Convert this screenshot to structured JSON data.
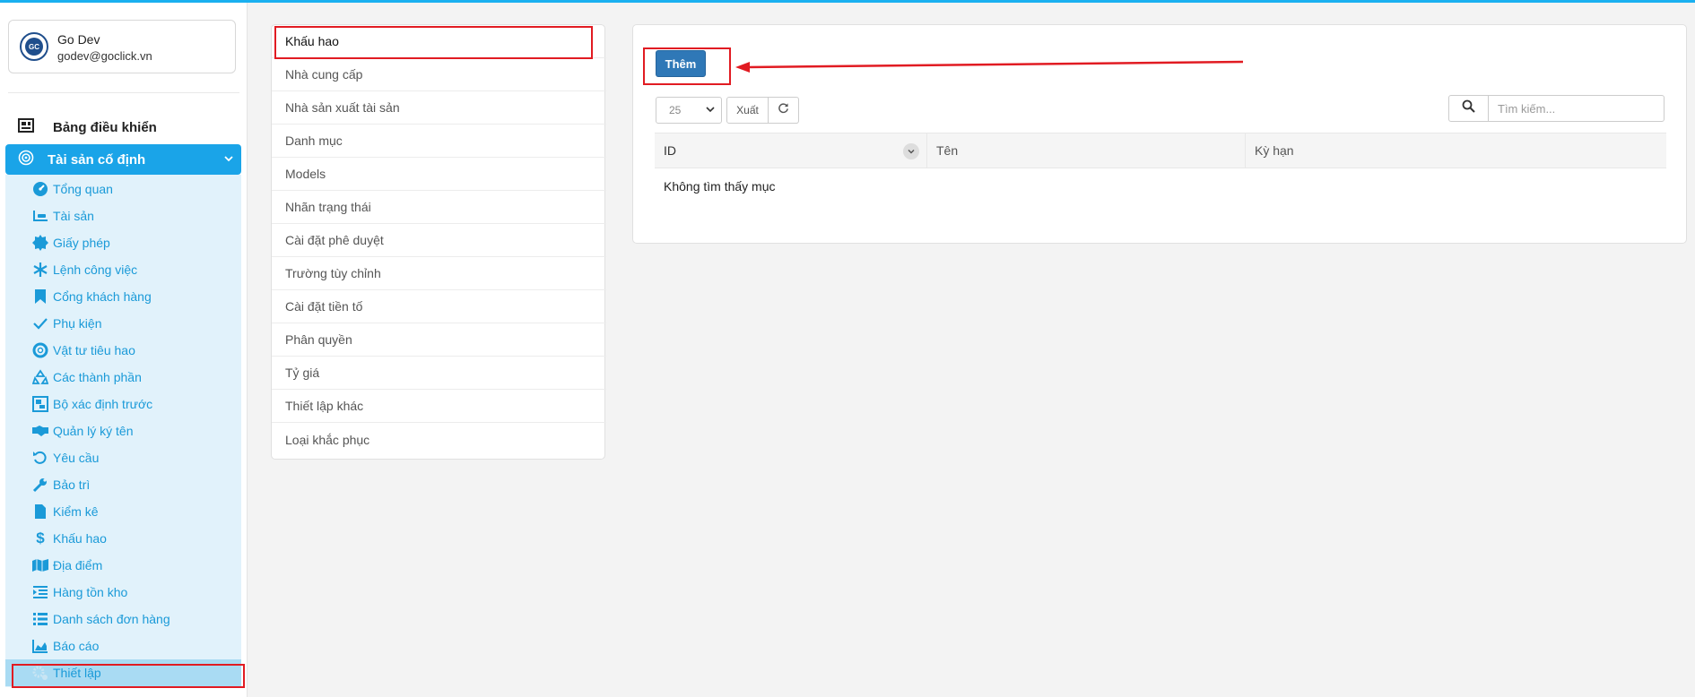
{
  "user": {
    "name": "Go Dev",
    "email": "godev@goclick.vn",
    "avatar_initials": "GC"
  },
  "sidebar": {
    "dashboard": {
      "label": "Bảng điều khiển",
      "icon": "dashboard-icon"
    },
    "group": {
      "label": "Tài sản cố định",
      "icon": "target-icon"
    },
    "items": [
      {
        "label": "Tổng quan",
        "icon": "gauge-icon"
      },
      {
        "label": "Tài sản",
        "icon": "barcode-icon"
      },
      {
        "label": "Giấy phép",
        "icon": "certificate-icon"
      },
      {
        "label": "Lệnh công việc",
        "icon": "snowflake-icon"
      },
      {
        "label": "Cổng khách hàng",
        "icon": "bookmark-icon"
      },
      {
        "label": "Phụ kiện",
        "icon": "check-icon"
      },
      {
        "label": "Vật tư tiêu hao",
        "icon": "lifebuoy-icon"
      },
      {
        "label": "Các thành phần",
        "icon": "recycle-icon"
      },
      {
        "label": "Bộ xác định trước",
        "icon": "object-group-icon"
      },
      {
        "label": "Quản lý ký tên",
        "icon": "handshake-icon"
      },
      {
        "label": "Yêu cầu",
        "icon": "undo-icon"
      },
      {
        "label": "Bảo trì",
        "icon": "wrench-icon"
      },
      {
        "label": "Kiểm kê",
        "icon": "file-icon"
      },
      {
        "label": "Khấu hao",
        "icon": "dollar-icon"
      },
      {
        "label": "Địa điểm",
        "icon": "map-icon"
      },
      {
        "label": "Hàng tồn kho",
        "icon": "indent-icon"
      },
      {
        "label": "Danh sách đơn hàng",
        "icon": "list-icon"
      },
      {
        "label": "Báo cáo",
        "icon": "area-chart-icon"
      },
      {
        "label": "Thiết lập",
        "icon": "cogs-icon"
      }
    ]
  },
  "settings_menu": [
    "Khấu hao",
    "Nhà cung cấp",
    "Nhà sản xuất tài sản",
    "Danh mục",
    "Models",
    "Nhãn trạng thái",
    "Cài đặt phê duyệt",
    "Trường tùy chỉnh",
    "Cài đặt tiền tố",
    "Phân quyền",
    "Tỷ giá",
    "Thiết lập khác",
    "Loại khắc phục"
  ],
  "content": {
    "add_label": "Thêm",
    "page_size": "25",
    "export_label": "Xuất",
    "search_placeholder": "Tìm kiếm...",
    "columns": {
      "id": "ID",
      "name": "Tên",
      "term": "Kỳ hạn"
    },
    "empty_message": "Không tìm thấy mục"
  },
  "colors": {
    "accent": "#1aa4e8",
    "button": "#2f78b7",
    "annotation": "#e11b22"
  }
}
